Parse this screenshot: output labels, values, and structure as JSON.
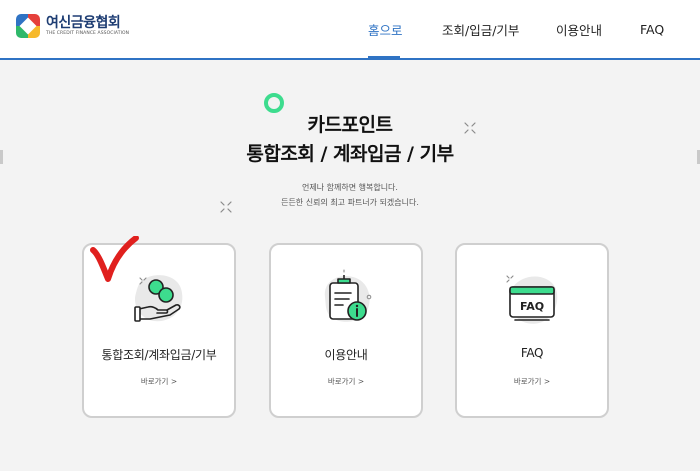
{
  "header": {
    "logo_title": "여신금융협회",
    "logo_subtitle": "THE CREDIT FINANCE ASSOCIATION",
    "nav": [
      {
        "label": "홈으로",
        "active": true
      },
      {
        "label": "조회/입금/기부",
        "active": false
      },
      {
        "label": "이용안내",
        "active": false
      },
      {
        "label": "FAQ",
        "active": false
      }
    ]
  },
  "hero": {
    "title_line1": "카드포인트",
    "title_line2": "통합조회 / 계좌입금 / 기부",
    "subtitle_line1": "언제나 함께하면 행복합니다.",
    "subtitle_line2": "든든한 신뢰의 최고 파트너가 되겠습니다."
  },
  "cards": [
    {
      "label": "통합조회/계좌입금/기부",
      "link": "바로가기 >",
      "icon": "coin-hand-icon"
    },
    {
      "label": "이용안내",
      "link": "바로가기 >",
      "icon": "clipboard-info-icon"
    },
    {
      "label": "FAQ",
      "link": "바로가기 >",
      "icon": "faq-monitor-icon"
    }
  ],
  "colors": {
    "accent": "#2f73c4",
    "mint": "#3ddc8e",
    "checkmark": "#e0201e"
  }
}
